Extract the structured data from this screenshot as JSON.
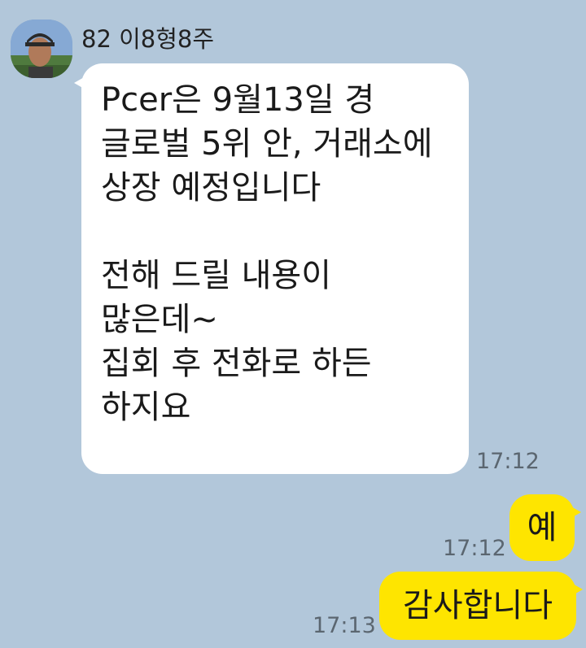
{
  "colors": {
    "background": "#b2c7da",
    "incoming_bubble": "#ffffff",
    "outgoing_bubble": "#fee500",
    "timestamp": "#5b6670"
  },
  "chat": {
    "sender_name": "82 이8형8주",
    "incoming": {
      "lines": [
        "Pcer은 9월13일 경",
        "글로벌 5위 안, 거래소에",
        "상장 예정입니다",
        "",
        "전해 드릴 내용이",
        "많은데~",
        "집회 후 전화로 하든",
        "하지요"
      ],
      "time": "17:12"
    },
    "outgoing": [
      {
        "text": "예",
        "time": "17:12"
      },
      {
        "text": "감사합니다",
        "time": "17:13"
      }
    ]
  }
}
